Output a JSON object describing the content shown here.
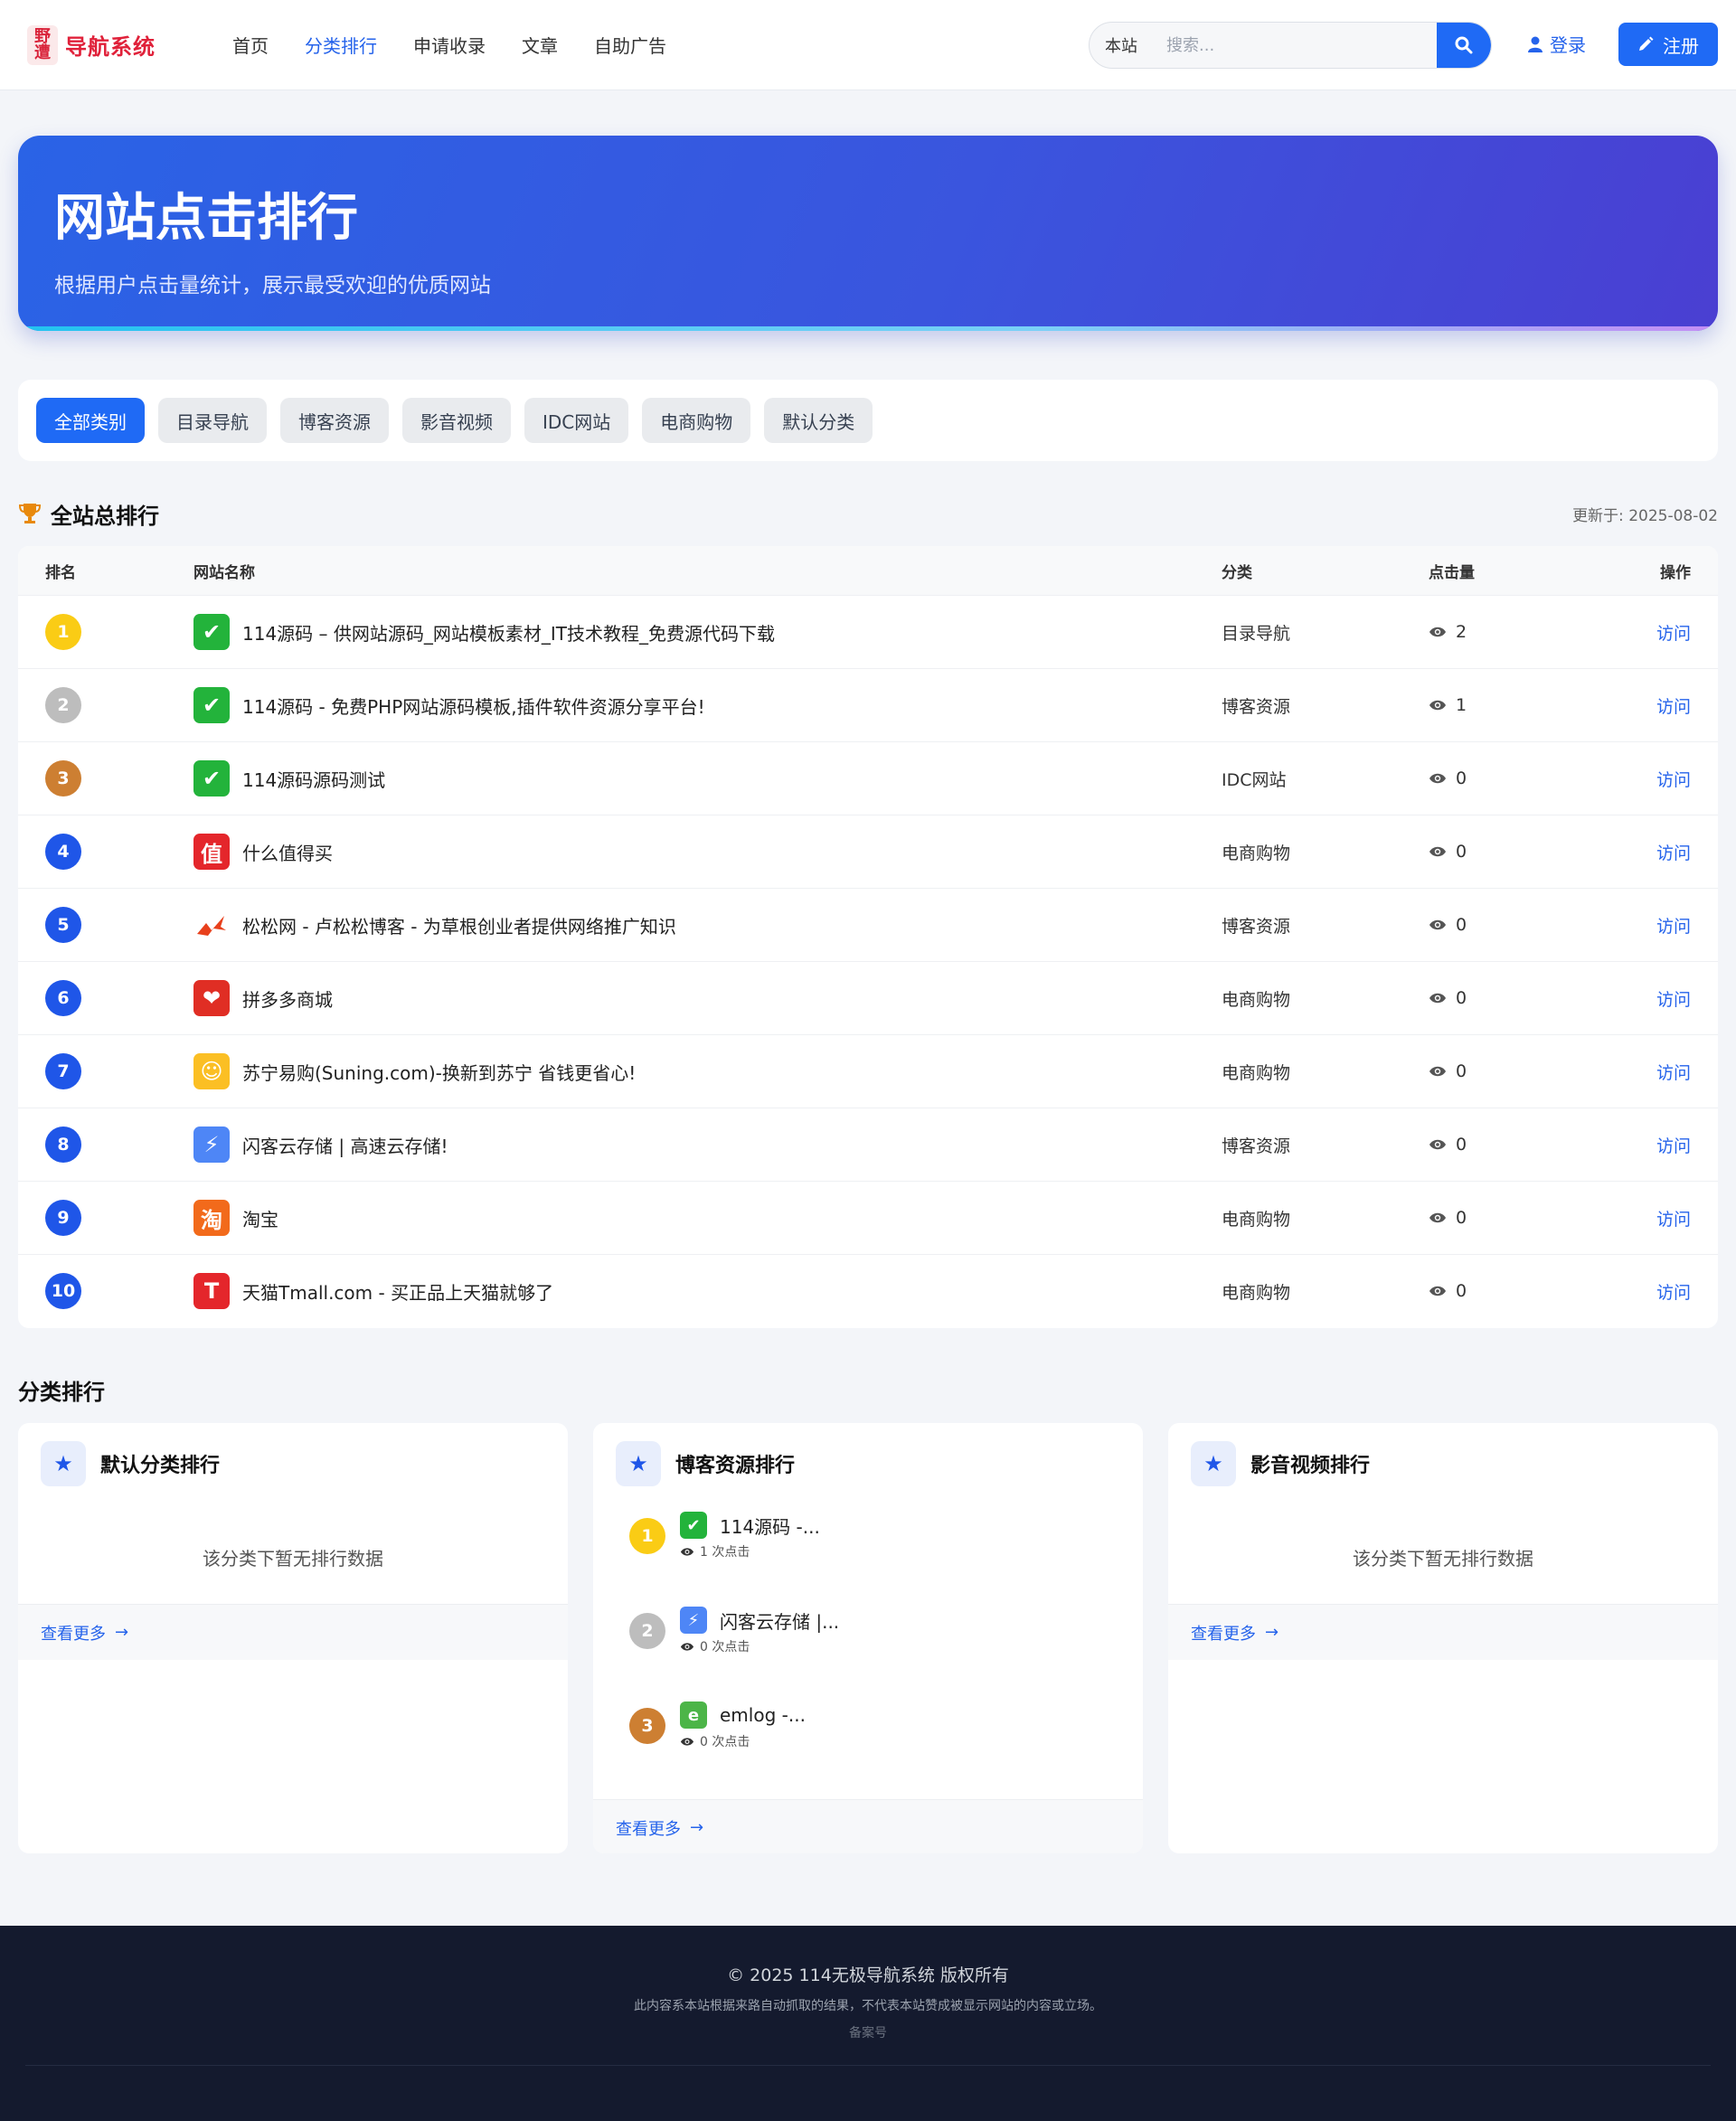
{
  "header": {
    "logo_text": "导航系统",
    "logo_mark": "野\n遭",
    "nav": [
      "首页",
      "分类排行",
      "申请收录",
      "文章",
      "自助广告"
    ],
    "nav_active": 1,
    "search_scope": "本站",
    "search_placeholder": "搜索...",
    "login_label": "登录",
    "register_label": "注册"
  },
  "hero": {
    "title": "网站点击排行",
    "subtitle": "根据用户点击量统计，展示最受欢迎的优质网站"
  },
  "filters": [
    "全部类别",
    "目录导航",
    "博客资源",
    "影音视频",
    "IDC网站",
    "电商购物",
    "默认分类"
  ],
  "overall": {
    "title": "全站总排行",
    "updated": "更新于: 2025-08-02",
    "columns": [
      "排名",
      "网站名称",
      "分类",
      "点击量",
      "操作"
    ],
    "action_label": "访问",
    "rows": [
      {
        "rank": "1",
        "name": "114源码 – 供网站源码_网站模板素材_IT技术教程_免费源代码下载",
        "category": "目录导航",
        "clicks": "2",
        "icon": "check-icon"
      },
      {
        "rank": "2",
        "name": "114源码 - 免费PHP网站源码模板,插件软件资源分享平台!",
        "category": "博客资源",
        "clicks": "1",
        "icon": "check-icon"
      },
      {
        "rank": "3",
        "name": "114源码源码测试",
        "category": "IDC网站",
        "clicks": "0",
        "icon": "check-icon"
      },
      {
        "rank": "4",
        "name": "什么值得买",
        "category": "电商购物",
        "clicks": "0",
        "icon": "smzdm-icon"
      },
      {
        "rank": "5",
        "name": "松松网 - 卢松松博客 - 为草根创业者提供网络推广知识",
        "category": "博客资源",
        "clicks": "0",
        "icon": "songsong-icon"
      },
      {
        "rank": "6",
        "name": "拼多多商城",
        "category": "电商购物",
        "clicks": "0",
        "icon": "pinduoduo-icon"
      },
      {
        "rank": "7",
        "name": "苏宁易购(Suning.com)-换新到苏宁 省钱更省心!",
        "category": "电商购物",
        "clicks": "0",
        "icon": "suning-icon"
      },
      {
        "rank": "8",
        "name": "闪客云存储 | 高速云存储!",
        "category": "博客资源",
        "clicks": "0",
        "icon": "lightning-icon"
      },
      {
        "rank": "9",
        "name": "淘宝",
        "category": "电商购物",
        "clicks": "0",
        "icon": "taobao-icon"
      },
      {
        "rank": "10",
        "name": "天猫Tmall.com - 买正品上天猫就够了",
        "category": "电商购物",
        "clicks": "0",
        "icon": "tmall-icon"
      }
    ]
  },
  "category_section": {
    "title": "分类排行",
    "more_label": "查看更多",
    "cards": [
      {
        "title": "默认分类排行",
        "empty_text": "该分类下暂无排行数据",
        "items": []
      },
      {
        "title": "博客资源排行",
        "empty_text": "",
        "items": [
          {
            "rank": "1",
            "name": "114源码 -...",
            "clicks": "1 次点击",
            "icon": "check-icon"
          },
          {
            "rank": "2",
            "name": "闪客云存储 |...",
            "clicks": "0 次点击",
            "icon": "lightning-icon"
          },
          {
            "rank": "3",
            "name": "emlog -...",
            "clicks": "0 次点击",
            "icon": "emlog-icon"
          }
        ]
      },
      {
        "title": "影音视频排行",
        "empty_text": "该分类下暂无排行数据",
        "items": []
      }
    ]
  },
  "footer": {
    "copyright": "© 2025 114无极导航系统 版权所有",
    "disclaimer": "此内容系本站根据来路自动抓取的结果，不代表本站赞成被显示网站的内容或立场。",
    "icp": "备案号"
  },
  "colors": {
    "primary": "#1f6af5",
    "gold": "#facc15",
    "silver": "#bdbdbd",
    "bronze": "#cd7f32",
    "footer_bg": "#141a2e"
  }
}
